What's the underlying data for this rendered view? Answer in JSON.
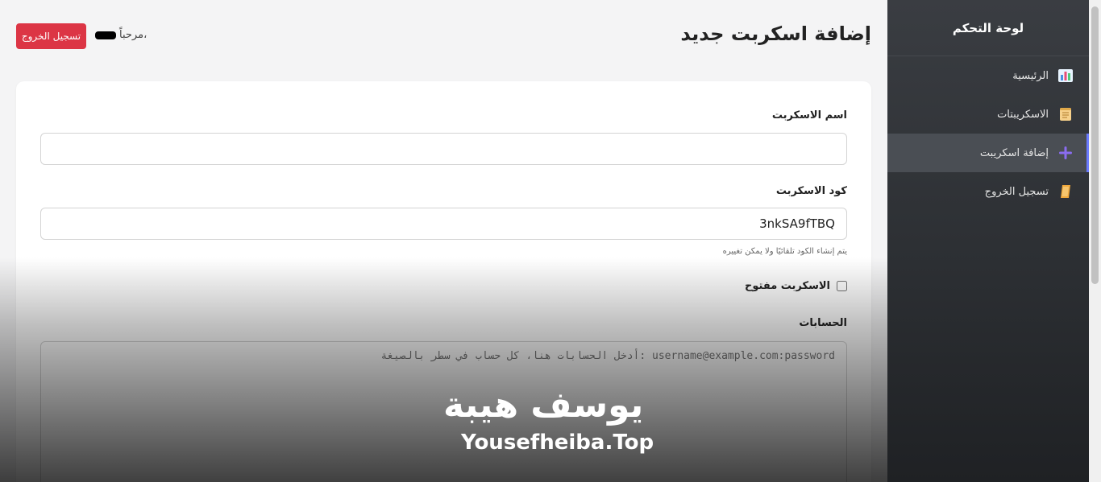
{
  "sidebar": {
    "title": "لوحة التحكم",
    "items": [
      {
        "label": "الرئيسية",
        "icon": "bar-chart-icon",
        "active": false
      },
      {
        "label": "الاسكريبتات",
        "icon": "scroll-icon",
        "active": false
      },
      {
        "label": "إضافة اسكريبت",
        "icon": "plus-icon",
        "active": true
      },
      {
        "label": "تسجيل الخروج",
        "icon": "logout-scroll-icon",
        "active": false
      }
    ]
  },
  "header": {
    "title": "إضافة اسكربت جديد",
    "welcome": "مرحباً،",
    "logout_label": "تسجيل الخروج"
  },
  "form": {
    "name_label": "اسم الاسكربت",
    "name_value": "",
    "code_label": "كود الاسكربت",
    "code_value": "3nkSA9fTBQ",
    "code_hint": "يتم إنشاء الكود تلقائيًا ولا يمكن تغييره",
    "open_label": "الاسكربت مفتوح",
    "accounts_label": "الحسابات",
    "accounts_placeholder": "أدخل الحسابات هنا، كل حساب في سطر بالصيغة: username@example.com:password"
  },
  "watermark": {
    "arabic": "يوسف هيبة",
    "english": "Yousefheiba.Top"
  },
  "colors": {
    "logout_button": "#dc3545",
    "active_accent": "#6b7cff",
    "sidebar_bg": "#2c2f33"
  }
}
